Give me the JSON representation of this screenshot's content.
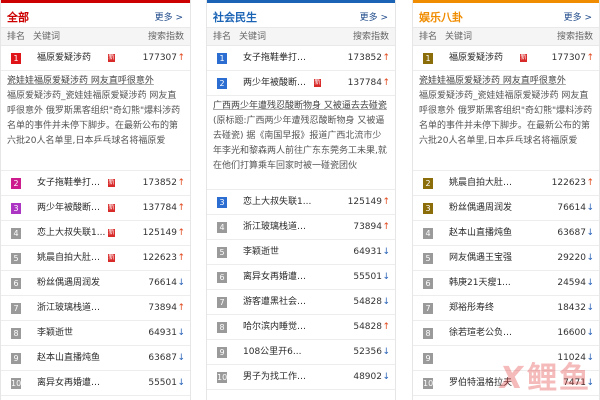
{
  "columns": [
    {
      "title": "全部",
      "more": "更多 >",
      "headers": {
        "rank": "排名",
        "keyword": "关键词",
        "index": "搜索指数"
      },
      "top": {
        "rank": "1",
        "keyword": "福原爱疑涉药",
        "new": "新",
        "index": "177307",
        "trend": "up"
      },
      "desc": {
        "lead": "瓷娃娃福原爱疑涉药 网友直呼很意外",
        "text": "福原爱疑涉药_瓷娃娃福原爱疑涉药 网友直呼很意外 俄罗斯黑客组织\"奇幻熊\"爆料涉药名单的事件并未停下脚步。在最新公布的第六批20人名单里,日本乒乓球名将福原爱"
      },
      "rows": [
        {
          "rank": "2",
          "keyword": "女子拖鞋拳打脚...",
          "new": "新",
          "index": "173852",
          "trend": "up"
        },
        {
          "rank": "3",
          "keyword": "两少年被酸断物...",
          "new": "新",
          "index": "137784",
          "trend": "up"
        },
        {
          "rank": "4",
          "keyword": "恋上大叔失联1...",
          "new": "新",
          "index": "125149",
          "trend": "up"
        },
        {
          "rank": "5",
          "keyword": "姚晨自拍大肚写...",
          "new": "新",
          "index": "122623",
          "trend": "up"
        },
        {
          "rank": "6",
          "keyword": "粉丝偶遇周润发",
          "new": "",
          "index": "76614",
          "trend": "down"
        },
        {
          "rank": "7",
          "keyword": "浙江玻璃栈道挤...",
          "new": "",
          "index": "73894",
          "trend": "up"
        },
        {
          "rank": "8",
          "keyword": "李颖逝世",
          "new": "",
          "index": "64931",
          "trend": "down"
        },
        {
          "rank": "9",
          "keyword": "赵本山直播炖鱼",
          "new": "",
          "index": "63687",
          "trend": "down"
        },
        {
          "rank": "10",
          "keyword": "离异女再婚遭家...",
          "new": "",
          "index": "55501",
          "trend": "down"
        }
      ]
    },
    {
      "title": "社会民生",
      "more": "更多 >",
      "headers": {
        "rank": "排名",
        "keyword": "关键词",
        "index": "搜索指数"
      },
      "top": {
        "rank": "1",
        "keyword": "女子拖鞋拳打脚...",
        "new": "",
        "index": "173852",
        "trend": "up"
      },
      "second": {
        "rank": "2",
        "keyword": "两少年被酸断物...",
        "new": "新",
        "index": "137784",
        "trend": "up"
      },
      "desc": {
        "lead": "广西两少年遭残忍酸断物身 又被逼去去碰瓷",
        "text": "(原标题:广西两少年遭残忍酸断物身 又被逼去碰瓷) 据《南国早报》报道广西北流市少年李光和黎森两人前往广东东莞务工未果,就在他们打算乘车回家时被一碰瓷团伙"
      },
      "rows": [
        {
          "rank": "3",
          "keyword": "恋上大叔失联1...",
          "new": "",
          "index": "125149",
          "trend": "up"
        },
        {
          "rank": "4",
          "keyword": "浙江玻璃栈道挤...",
          "new": "",
          "index": "73894",
          "trend": "up"
        },
        {
          "rank": "5",
          "keyword": "李颖逝世",
          "new": "",
          "index": "64931",
          "trend": "down"
        },
        {
          "rank": "6",
          "keyword": "离异女再婚遭家...",
          "new": "",
          "index": "55501",
          "trend": "down"
        },
        {
          "rank": "7",
          "keyword": "游客遭黑社会欺...",
          "new": "",
          "index": "54828",
          "trend": "down"
        },
        {
          "rank": "8",
          "keyword": "哈尔滨内睡觉大...",
          "new": "",
          "index": "54828",
          "trend": "up"
        },
        {
          "rank": "9",
          "keyword": "108公里开6...",
          "new": "",
          "index": "52356",
          "trend": "down"
        },
        {
          "rank": "10",
          "keyword": "男子为找工作假...",
          "new": "",
          "index": "48902",
          "trend": "down"
        }
      ]
    },
    {
      "title": "娱乐八卦",
      "more": "更多 >",
      "headers": {
        "rank": "排名",
        "keyword": "关键词",
        "index": "搜索指数"
      },
      "top": {
        "rank": "1",
        "keyword": "福原爱疑涉药",
        "new": "新",
        "index": "177307",
        "trend": "up"
      },
      "desc": {
        "lead": "瓷娃娃福原爱疑涉药 网友直呼很意外",
        "text": "福原爱疑涉药_瓷娃娃福原爱疑涉药 网友直呼很意外 俄罗斯黑客组织\"奇幻熊\"爆料涉药名单的事件并未停下脚步。在最新公布的第六批20人名单里,日本乒乓球名将福原爱"
      },
      "rows": [
        {
          "rank": "2",
          "keyword": "姚晨自拍大肚写...",
          "new": "",
          "index": "122623",
          "trend": "up"
        },
        {
          "rank": "3",
          "keyword": "粉丝偶遇周润发",
          "new": "",
          "index": "76614",
          "trend": "down"
        },
        {
          "rank": "4",
          "keyword": "赵本山直播炖鱼",
          "new": "",
          "index": "63687",
          "trend": "down"
        },
        {
          "rank": "5",
          "keyword": "网友偶遇王宝强",
          "new": "",
          "index": "29220",
          "trend": "down"
        },
        {
          "rank": "6",
          "keyword": "韩庚21天瘦1...",
          "new": "",
          "index": "24594",
          "trend": "down"
        },
        {
          "rank": "7",
          "keyword": "郑裕彤寿终",
          "new": "",
          "index": "18432",
          "trend": "down"
        },
        {
          "rank": "8",
          "keyword": "徐若瑄老公负巨...",
          "new": "",
          "index": "16600",
          "trend": "down"
        },
        {
          "rank": "9",
          "keyword": "",
          "new": "",
          "index": "11024",
          "trend": "down"
        },
        {
          "rank": "10",
          "keyword": "罗伯特温格拉夫",
          "new": "",
          "index": "7471",
          "trend": "down"
        }
      ]
    }
  ],
  "watermark": {
    "x": "X",
    "text": "鲤鱼"
  },
  "colors": {
    "all": "#cc0000",
    "social": "#1a63b5",
    "ent": "#f08c00",
    "up": "#e14a20",
    "down": "#2863b8"
  },
  "icons": {
    "up": "arrow-up-icon",
    "down": "arrow-down-icon"
  }
}
